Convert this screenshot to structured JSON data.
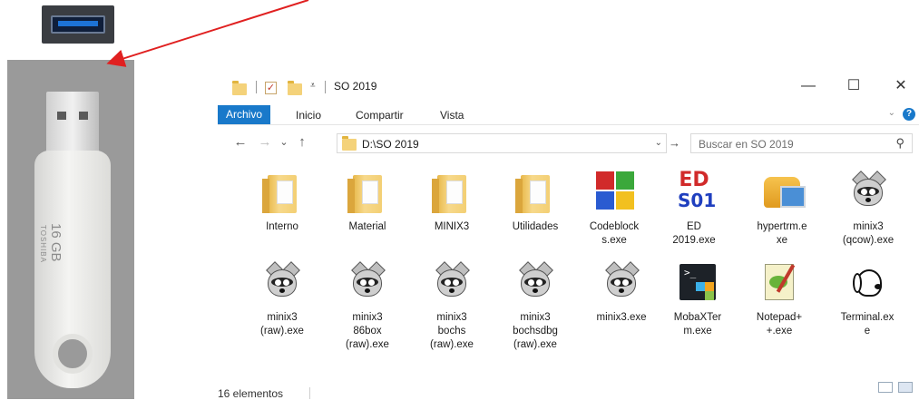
{
  "window": {
    "title": "SO 2019",
    "minimize": "—",
    "maximize": "☐",
    "close": "✕"
  },
  "ribbon": {
    "tabs": [
      "Archivo",
      "Inicio",
      "Compartir",
      "Vista"
    ],
    "help": "?"
  },
  "navigation": {
    "back": "←",
    "forward": "→",
    "recent": "⌄",
    "up": "↑",
    "address": "D:\\SO 2019",
    "go": "→",
    "search_placeholder": "Buscar en SO 2019"
  },
  "items": [
    {
      "name": "Interno",
      "icon": "folder-icon"
    },
    {
      "name": "Material",
      "icon": "folder-icon"
    },
    {
      "name": "MINIX3",
      "icon": "folder-icon"
    },
    {
      "name": "Utilidades",
      "icon": "folder-icon"
    },
    {
      "name": "Codeblocks.exe",
      "icon": "codeblocks-icon"
    },
    {
      "name": "ED 2019.exe",
      "icon": "ed-icon"
    },
    {
      "name": "hypertrm.exe",
      "icon": "hyperterminal-icon"
    },
    {
      "name": "minix3 (qcow).exe",
      "icon": "raccoon-icon"
    },
    {
      "name": "minix3 (raw).exe",
      "icon": "raccoon-icon"
    },
    {
      "name": "minix3 86box (raw).exe",
      "icon": "raccoon-icon"
    },
    {
      "name": "minix3 bochs (raw).exe",
      "icon": "raccoon-icon"
    },
    {
      "name": "minix3 bochsdbg (raw).exe",
      "icon": "raccoon-icon"
    },
    {
      "name": "minix3.exe",
      "icon": "raccoon-icon"
    },
    {
      "name": "MobaXTerm.exe",
      "icon": "mobaxterm-icon"
    },
    {
      "name": "Notepad++.exe",
      "icon": "notepadpp-icon"
    },
    {
      "name": "Terminal.exe",
      "icon": "dog-icon"
    }
  ],
  "item_labels": [
    [
      "Interno"
    ],
    [
      "Material"
    ],
    [
      "MINIX3"
    ],
    [
      "Utilidades"
    ],
    [
      "Codeblock",
      "s.exe"
    ],
    [
      "ED",
      "2019.exe"
    ],
    [
      "hypertrm.e",
      "xe"
    ],
    [
      "minix3",
      "(qcow).exe"
    ],
    [
      "minix3",
      "(raw).exe"
    ],
    [
      "minix3",
      "86box",
      "(raw).exe"
    ],
    [
      "minix3",
      "bochs",
      "(raw).exe"
    ],
    [
      "minix3",
      "bochsdbg",
      "(raw).exe"
    ],
    [
      "minix3.exe"
    ],
    [
      "MobaXTer",
      "m.exe"
    ],
    [
      "Notepad+",
      "+.exe"
    ],
    [
      "Terminal.ex",
      "e"
    ]
  ],
  "status": {
    "count": "16 elementos"
  },
  "usb_stick": {
    "capacity": "16 GB",
    "brand": "TOSHIBA"
  },
  "colors": {
    "accent": "#1979ca",
    "arrow": "#e02020",
    "folder": "#f4d27a"
  }
}
